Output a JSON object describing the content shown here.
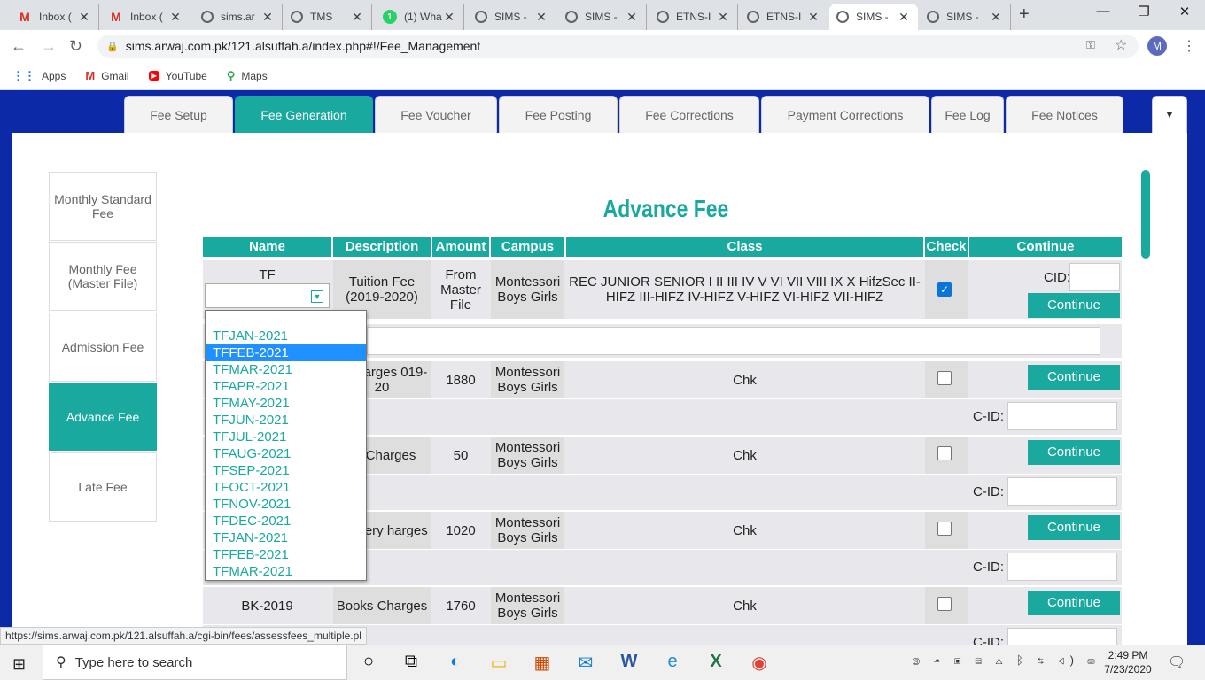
{
  "browser": {
    "tabs": [
      {
        "title": "Inbox (",
        "icon": "gmail-icon"
      },
      {
        "title": "Inbox (",
        "icon": "gmail-icon"
      },
      {
        "title": "sims.ar",
        "icon": "globe-icon"
      },
      {
        "title": "TMS",
        "icon": "globe-icon"
      },
      {
        "title": "(1) Wha",
        "icon": "whatsapp-icon"
      },
      {
        "title": "SIMS -",
        "icon": "globe-icon"
      },
      {
        "title": "SIMS -",
        "icon": "globe-icon"
      },
      {
        "title": "ETNS-I",
        "icon": "globe-icon"
      },
      {
        "title": "ETNS-I",
        "icon": "globe-icon"
      },
      {
        "title": "SIMS -",
        "icon": "globe-icon"
      },
      {
        "title": "SIMS -",
        "icon": "globe-icon"
      }
    ],
    "url": "sims.arwaj.com.pk/121.alsuffah.a/index.php#!/Fee_Management",
    "avatar_letter": "M",
    "bookmarks": [
      "Apps",
      "Gmail",
      "YouTube",
      "Maps"
    ]
  },
  "fee_tabs": [
    "Fee Setup",
    "Fee Generation",
    "Fee Voucher",
    "Fee Posting",
    "Fee Corrections",
    "Payment Corrections",
    "Fee Log",
    "Fee Notices"
  ],
  "sidebar": [
    "Monthly Standard Fee",
    "Monthly Fee (Master File)",
    "Admission Fee",
    "Advance Fee",
    "Late Fee"
  ],
  "page_title": "Advance Fee",
  "table": {
    "headers": [
      "Name",
      "Description",
      "Amount",
      "Campus",
      "Class",
      "Check",
      "Continue"
    ],
    "rows": [
      {
        "name": "TF",
        "description": "Tuition Fee (2019-2020)",
        "amount": "From Master File",
        "campus": "Montessori Boys Girls",
        "class": "REC JUNIOR SENIOR I II III IV V VI VII VIII IX X HifzSec II-HIFZ III-HIFZ IV-HIFZ V-HIFZ VI-HIFZ VII-HIFZ",
        "checked": true,
        "cid_label": "CID:"
      },
      {
        "name": "",
        "description": "k Charges 019-20",
        "amount": "1880",
        "campus": "Montessori Boys Girls",
        "class": "Chk",
        "checked": false,
        "cid_label": "C-ID:"
      },
      {
        "name": "",
        "description": "es Charges",
        "amount": "50",
        "campus": "Montessori Boys Girls",
        "class": "Chk",
        "checked": false,
        "cid_label": "C-ID:"
      },
      {
        "name": "",
        "description": "ationery harges",
        "amount": "1020",
        "campus": "Montessori Boys Girls",
        "class": "Chk",
        "checked": false,
        "cid_label": "C-ID:"
      },
      {
        "name": "BK-2019",
        "description": "Books Charges",
        "amount": "1760",
        "campus": "Montessori Boys Girls",
        "class": "Chk",
        "checked": false,
        "cid_label": "C-ID:"
      }
    ],
    "continue_label": "Continue"
  },
  "dropdown": {
    "options": [
      "",
      "TFJAN-2021",
      "TFFEB-2021",
      "TFMAR-2021",
      "TFAPR-2021",
      "TFMAY-2021",
      "TFJUN-2021",
      "TFJUL-2021",
      "TFAUG-2021",
      "TFSEP-2021",
      "TFOCT-2021",
      "TFNOV-2021",
      "TFDEC-2021",
      "TFJAN-2021",
      "TFFEB-2021",
      "TFMAR-2021"
    ],
    "highlighted": "TFFEB-2021"
  },
  "status_url": "https://sims.arwaj.com.pk/121.alsuffah.a/cgi-bin/fees/assessfees_multiple.pl",
  "taskbar": {
    "search_placeholder": "Type here to search",
    "time": "2:49 PM",
    "date": "7/23/2020"
  },
  "colors": {
    "accent": "#1aa99e",
    "page_bg": "#0c2aa8",
    "highlight": "#1e90ff"
  }
}
